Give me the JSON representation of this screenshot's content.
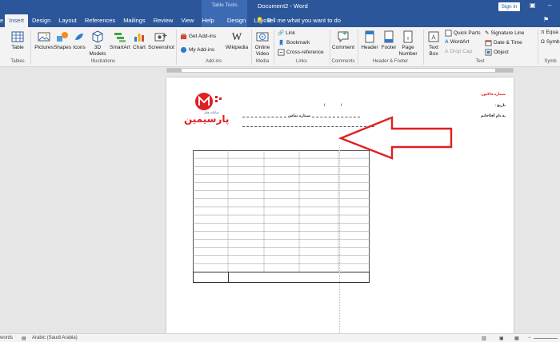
{
  "window": {
    "title": "Document2 - Word",
    "contextual_group": "Table Tools",
    "tell_me": "Tell me what you want to do",
    "sign_in": "Sign in"
  },
  "tabs": [
    "e",
    "Insert",
    "Design",
    "Layout",
    "References",
    "Mailings",
    "Review",
    "View",
    "Help",
    "Design",
    "Layout"
  ],
  "active_tab": "Insert",
  "ribbon": {
    "tables": {
      "table": "Table",
      "group": "Tables"
    },
    "illustrations": {
      "pictures": "Pictures",
      "shapes": "Shapes",
      "icons": "Icons",
      "models_3d": "3D",
      "models_3d_2": "Models",
      "smartart": "SmartArt",
      "chart": "Chart",
      "screenshot": "Screenshot",
      "group": "Illustrations"
    },
    "addins": {
      "get": "Get Add-ins",
      "my": "My Add-ins",
      "wikipedia": "Wikipedia",
      "group": "Add-ins"
    },
    "media": {
      "online": "Online",
      "video": "Video",
      "group": "Media"
    },
    "links": {
      "link": "Link",
      "bookmark": "Bookmark",
      "crossref": "Cross-reference",
      "group": "Links"
    },
    "comments": {
      "comment": "Comment",
      "group": "Comments"
    },
    "header_footer": {
      "header": "Header",
      "footer": "Footer",
      "page": "Page",
      "number": "Number",
      "group": "Header & Footer"
    },
    "text": {
      "textbox": "Text",
      "textbox_2": "Box",
      "quickparts": "Quick Parts",
      "wordart": "WordArt",
      "dropcap": "Drop Cap",
      "signature": "Signature Line",
      "datetime": "Date & Time",
      "object": "Object",
      "group": "Text"
    },
    "symbols": {
      "equation": "Equa",
      "symbol": "Symb",
      "group": "Symb"
    }
  },
  "document": {
    "logo_text": "پارسیمین",
    "logo_sub": "سامانه های",
    "invoice_no": "شماره فاکتور:",
    "date_label": "تاریخ :",
    "date_sep1": "/",
    "date_sep2": "/",
    "recipient": "به نام آقا/خانم",
    "contact": "شماره تماس",
    "table_rows": 15,
    "table_cols": 5
  },
  "status": {
    "words": "words",
    "language": "Arabic (Saudi Arabia)"
  },
  "colors": {
    "accent": "#2b579a",
    "arrow": "#e02020",
    "logo": "#e01f26"
  }
}
